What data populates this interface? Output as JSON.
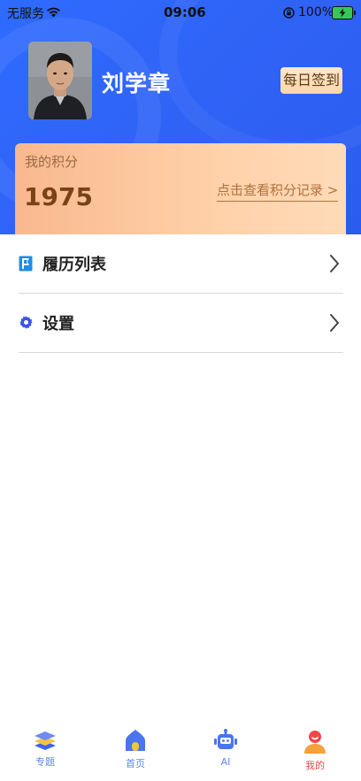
{
  "status_bar": {
    "carrier": "无服务",
    "time": "09:06",
    "battery": "100%"
  },
  "profile": {
    "name": "刘学章",
    "checkin_label": "每日签到"
  },
  "points": {
    "label": "我的积分",
    "value": "1975",
    "link_label": "点击查看积分记录 >"
  },
  "menu": [
    {
      "label": "履历列表",
      "icon": "bookmark-icon"
    },
    {
      "label": "设置",
      "icon": "gear-icon"
    }
  ],
  "tabs": [
    {
      "label": "专题",
      "icon": "layers-icon"
    },
    {
      "label": "首页",
      "icon": "home-icon"
    },
    {
      "label": "AI",
      "icon": "robot-icon"
    },
    {
      "label": "我的",
      "icon": "person-icon",
      "active": true
    }
  ],
  "colors": {
    "header_blue": "#2f6bff",
    "points_card": "#ffd1a9",
    "tab_active": "#f04848",
    "tab_inactive": "#5b86f5"
  }
}
